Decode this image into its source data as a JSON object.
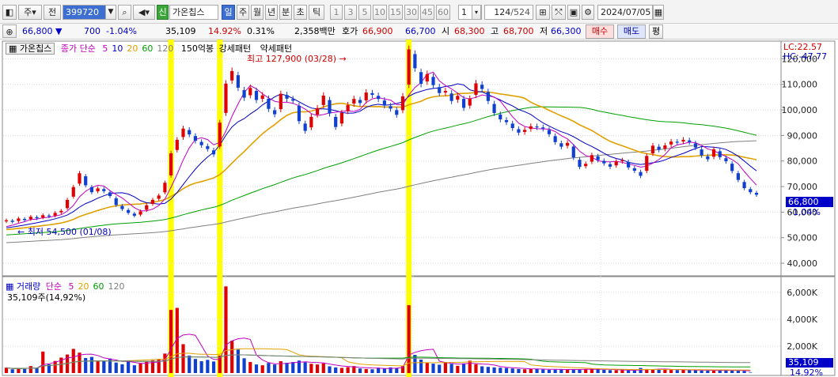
{
  "toolbar": {
    "code": "399720",
    "btn_left": "주",
    "btn_prev": "전",
    "tag": "신",
    "stock_name": "가온칩스",
    "periods": [
      "일",
      "주",
      "월",
      "년",
      "분",
      "초",
      "틱"
    ],
    "numbers": [
      "1",
      "3",
      "5",
      "10",
      "15",
      "30",
      "45",
      "60"
    ],
    "interval_value": "1",
    "count": "124",
    "total": "/524",
    "date": "2024/07/05"
  },
  "quote": {
    "price": "66,800",
    "change": "700",
    "change_pct": "-1.04%",
    "volume": "35,109",
    "vol_pct": "14.92%",
    "turnover_pct": "0.31%",
    "amount": "2,358백만",
    "ask_label": "호가",
    "ask": "66,900",
    "bid": "66,700",
    "open_label": "시",
    "open": "68,300",
    "high_label": "고",
    "high": "68,700",
    "low_label": "저",
    "low": "66,300",
    "sell_btn": "매수",
    "buy_btn": "매도",
    "eval_btn": "평"
  },
  "price_panel": {
    "name": "가온칩스",
    "ma_label": "종가 단순",
    "ma_periods": [
      "5",
      "10",
      "20",
      "60",
      "120"
    ],
    "ma_colors": [
      "#c000c0",
      "#0000c0",
      "#e0a000",
      "#00a000",
      "#808080"
    ],
    "pattern1": "150억봉",
    "pattern2": "강세패턴",
    "pattern3": "약세패턴",
    "high_note": "최고 127,900 (03/28)",
    "low_note": "최저 54,500 (01/08)",
    "lc": "LC:22.57",
    "hc": "HC:-47.77",
    "current_price": "66,800",
    "current_pct": "-1.04%",
    "y_ticks": [
      "120,000",
      "110,000",
      "100,000",
      "90,000",
      "80,000",
      "70,000",
      "60,000",
      "50,000",
      "40,000"
    ]
  },
  "volume_panel": {
    "label": "거래량",
    "ma_label": "단순",
    "ma_periods": [
      "5",
      "20",
      "60",
      "120"
    ],
    "ma_colors": [
      "#c000c0",
      "#e0a000",
      "#00a000",
      "#808080"
    ],
    "current": "35,109주(14,92%)",
    "current_volume": "35,109",
    "current_pct": "14.92%",
    "y_ticks": [
      "6,000K",
      "4,000K",
      "2,000K"
    ]
  },
  "chart_data": {
    "type": "candlestick",
    "y_range": [
      36000,
      126000
    ],
    "markers": {
      "max": 127900,
      "max_date": "03/28",
      "min": 54500,
      "min_date": "01/08"
    },
    "closes": [
      56800,
      56200,
      57500,
      56900,
      58200,
      57600,
      58800,
      58300,
      59700,
      60500,
      64800,
      69800,
      75200,
      70500,
      67800,
      69300,
      68200,
      66300,
      62800,
      61200,
      59700,
      58600,
      60300,
      62700,
      64800,
      66500,
      71500,
      83000,
      88300,
      92700,
      90400,
      87900,
      86200,
      84700,
      82600,
      95000,
      110300,
      115200,
      108700,
      104800,
      108600,
      103900,
      105700,
      100400,
      98300,
      106300,
      104400,
      103600,
      95600,
      91800,
      97300,
      100700,
      105600,
      98600,
      93300,
      98800,
      101900,
      104300,
      102700,
      106800,
      105900,
      104300,
      101800,
      100500,
      98100,
      105300,
      123700,
      116300,
      110200,
      114000,
      109700,
      106600,
      107400,
      103500,
      105500,
      100800,
      104400,
      110400,
      108200,
      103500,
      98800,
      96300,
      95200,
      92900,
      91100,
      92200,
      93600,
      93300,
      92700,
      90500,
      87400,
      85600,
      87100,
      81400,
      77700,
      78900,
      82300,
      80400,
      79100,
      77800,
      79800,
      80300,
      77500,
      76200,
      74200,
      82000,
      86000,
      84400,
      86100,
      87600,
      87400,
      88300,
      87400,
      85300,
      82200,
      80700,
      84600,
      81500,
      79900,
      76100,
      72600,
      69400,
      67800,
      66800
    ],
    "volumes_k": [
      400,
      280,
      360,
      300,
      520,
      380,
      1600,
      650,
      900,
      1150,
      1380,
      1800,
      1520,
      1120,
      1200,
      880,
      920,
      1080,
      780,
      650,
      880,
      580,
      720,
      850,
      950,
      1000,
      1450,
      4700,
      4850,
      2150,
      1300,
      1050,
      880,
      980,
      860,
      1300,
      6450,
      2400,
      1750,
      1100,
      820,
      640,
      580,
      750,
      640,
      880,
      760,
      820,
      930,
      800,
      690,
      640,
      720,
      500,
      420,
      380,
      440,
      520,
      340,
      300,
      280,
      400,
      350,
      420,
      360,
      520,
      5050,
      1350,
      1000,
      760,
      700,
      620,
      820,
      680,
      540,
      720,
      920,
      660,
      500,
      460,
      420,
      400,
      380,
      340,
      300,
      280,
      300,
      320,
      260,
      240,
      250,
      290,
      280,
      260,
      240,
      300,
      320,
      280,
      240,
      220,
      210,
      220,
      200,
      180,
      380,
      300,
      260,
      320,
      250,
      230,
      220,
      240,
      230,
      210,
      190,
      180,
      200,
      220,
      210,
      190,
      170,
      160,
      35
    ],
    "highlight_indices": [
      27,
      35,
      66
    ]
  }
}
